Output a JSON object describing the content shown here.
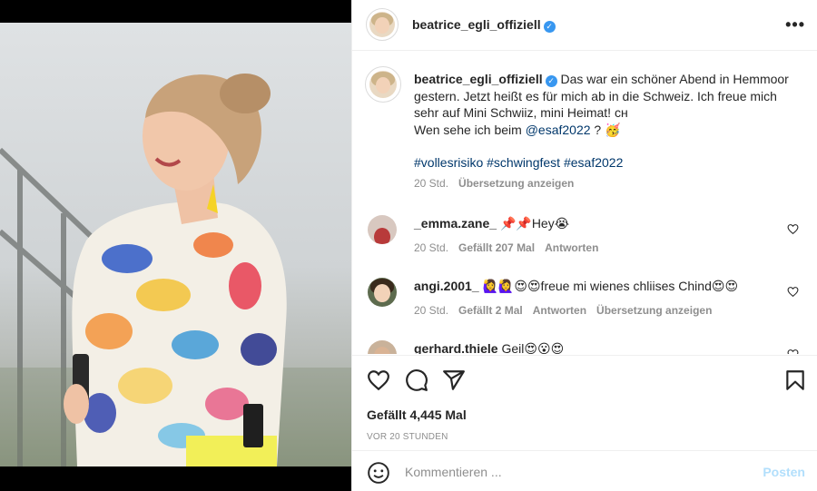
{
  "post": {
    "author": "beatrice_egli_offiziell",
    "verified_mark": "✓",
    "more_icon": "more-horizontal-icon",
    "photo_description_icon": "post-photo"
  },
  "caption": {
    "author": "beatrice_egli_offiziell",
    "text_1": "Das war ein schöner Abend in Hemmoor gestern. Jetzt heißt es für mich ab in die Schweiz. Ich freue mich sehr auf Mini Schwiiz, mini Heimat! ᴄʜ",
    "text_2": "Wen sehe ich beim ",
    "mention": "@esaf2022",
    "text_3": " ? 🥳",
    "hashtags": "#vollesrisiko #schwingfest #esaf2022",
    "time": "20 Std.",
    "translate": "Übersetzung anzeigen"
  },
  "comments": [
    {
      "user": "_emma.zane_",
      "text": "📌📌Hey😭",
      "time": "20 Std.",
      "likes": "Gefällt 207 Mal",
      "reply": "Antworten",
      "translate": ""
    },
    {
      "user": "angi.2001_",
      "text": "🙋‍♀️🙋‍♀️😍😍freue mi wienes chliises Chind😍😍",
      "time": "20 Std.",
      "likes": "Gefällt 2 Mal",
      "reply": "Antworten",
      "translate": "Übersetzung anzeigen"
    },
    {
      "user": "gerhard.thiele",
      "text": "Geil😍😮😍",
      "time": "",
      "likes": "",
      "reply": "",
      "translate": ""
    }
  ],
  "actions": {
    "likes": "Gefällt 4,445 Mal",
    "ago": "VOR 20 STUNDEN",
    "comment_placeholder": "Kommentieren ...",
    "post_label": "Posten"
  },
  "colors": {
    "link": "#00376b",
    "muted": "#8e8e8e",
    "post_disabled": "#b2dffc",
    "verified": "#3897f0"
  }
}
